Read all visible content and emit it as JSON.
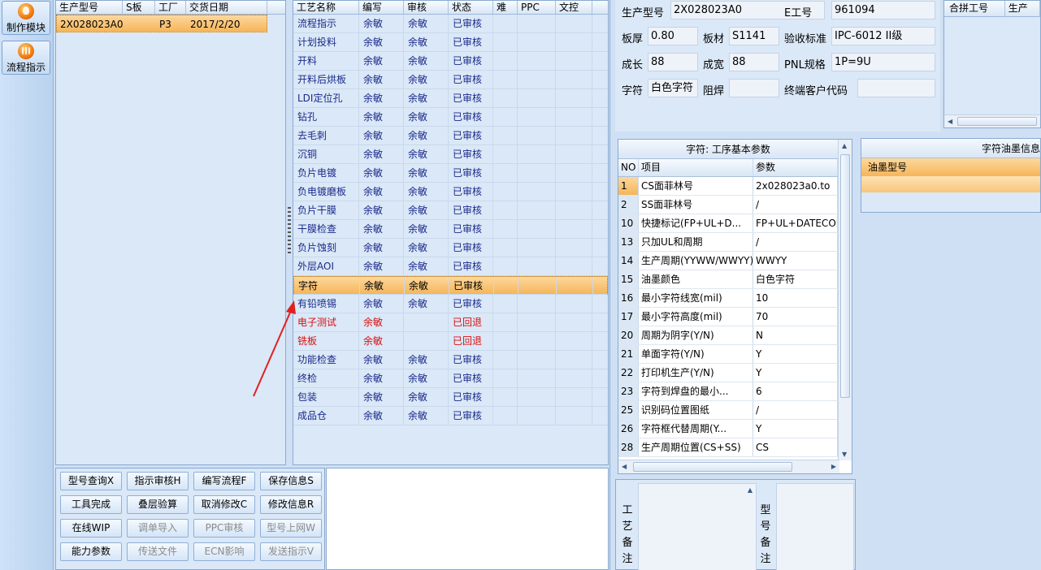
{
  "toolbar": {
    "make_module": "制作模块",
    "flow_guide": "流程指示"
  },
  "model_list": {
    "columns": [
      "生产型号",
      "S板",
      "工厂",
      "交货日期"
    ],
    "rows": [
      {
        "model": "2X028023A0",
        "s_board": "",
        "factory": "P3",
        "delivery": "2017/2/20"
      }
    ]
  },
  "process_table": {
    "columns": [
      "工艺名称",
      "编写",
      "审核",
      "状态",
      "难",
      "PPC",
      "文控"
    ],
    "rows": [
      {
        "name": "流程指示",
        "writer": "余敏",
        "reviewer": "余敏",
        "status": "已审核"
      },
      {
        "name": "计划投料",
        "writer": "余敏",
        "reviewer": "余敏",
        "status": "已审核"
      },
      {
        "name": "开料",
        "writer": "余敏",
        "reviewer": "余敏",
        "status": "已审核"
      },
      {
        "name": "开料后烘板",
        "writer": "余敏",
        "reviewer": "余敏",
        "status": "已审核"
      },
      {
        "name": "LDI定位孔",
        "writer": "余敏",
        "reviewer": "余敏",
        "status": "已审核"
      },
      {
        "name": "钻孔",
        "writer": "余敏",
        "reviewer": "余敏",
        "status": "已审核"
      },
      {
        "name": "去毛刺",
        "writer": "余敏",
        "reviewer": "余敏",
        "status": "已审核"
      },
      {
        "name": "沉铜",
        "writer": "余敏",
        "reviewer": "余敏",
        "status": "已审核"
      },
      {
        "name": "负片电镀",
        "writer": "余敏",
        "reviewer": "余敏",
        "status": "已审核"
      },
      {
        "name": "负电镀磨板",
        "writer": "余敏",
        "reviewer": "余敏",
        "status": "已审核"
      },
      {
        "name": "负片干膜",
        "writer": "余敏",
        "reviewer": "余敏",
        "status": "已审核"
      },
      {
        "name": "干膜检查",
        "writer": "余敏",
        "reviewer": "余敏",
        "status": "已审核"
      },
      {
        "name": "负片蚀刻",
        "writer": "余敏",
        "reviewer": "余敏",
        "status": "已审核"
      },
      {
        "name": "外层AOI",
        "writer": "余敏",
        "reviewer": "余敏",
        "status": "已审核"
      },
      {
        "name": "字符",
        "writer": "余敏",
        "reviewer": "余敏",
        "status": "已审核"
      },
      {
        "name": "有铅喷锡",
        "writer": "余敏",
        "reviewer": "余敏",
        "status": "已审核"
      },
      {
        "name": "电子测试",
        "writer": "余敏",
        "reviewer": "",
        "status": "已回退"
      },
      {
        "name": "铣板",
        "writer": "余敏",
        "reviewer": "",
        "status": "已回退"
      },
      {
        "name": "功能检查",
        "writer": "余敏",
        "reviewer": "余敏",
        "status": "已审核"
      },
      {
        "name": "终检",
        "writer": "余敏",
        "reviewer": "余敏",
        "status": "已审核"
      },
      {
        "name": "包装",
        "writer": "余敏",
        "reviewer": "余敏",
        "status": "已审核"
      },
      {
        "name": "成品仓",
        "writer": "余敏",
        "reviewer": "余敏",
        "status": "已审核"
      }
    ]
  },
  "buttons": {
    "model_query": "型号查询X",
    "guide_review": "指示审核H",
    "edit_flow": "编写流程F",
    "save_info": "保存信息S",
    "tool_done": "工具完成",
    "stack_calc": "叠层验算",
    "cancel_edit": "取消修改C",
    "modify_info": "修改信息R",
    "online_wip": "在线WIP",
    "import_sheet": "调单导入",
    "ppc_review": "PPC审核",
    "model_online": "型号上网W",
    "capability": "能力参数",
    "send_file": "传送文件",
    "ecn_impact": "ECN影响",
    "send_guide": "发送指示V"
  },
  "info": {
    "model_label": "生产型号",
    "model_value": "2X028023A0",
    "e_label": "E工号",
    "e_value": "961094",
    "thickness_label": "板厚",
    "thickness_value": "0.80",
    "material_label": "板材",
    "material_value": "S1141",
    "standard_label": "验收标准",
    "standard_value": "IPC-6012 II级",
    "length_label": "成长",
    "length_value": "88",
    "width_label": "成宽",
    "width_value": "88",
    "pnl_label": "PNL规格",
    "pnl_value": "1P=9U",
    "char_label": "字符",
    "char_value": "白色字符",
    "mask_label": "阻焊",
    "mask_value": "",
    "customer_label": "终端客户代码",
    "customer_value": ""
  },
  "right_top": {
    "col1": "合拼工号",
    "col2": "生产"
  },
  "params": {
    "title": "字符: 工序基本参数",
    "columns": [
      "NO",
      "项目",
      "参数"
    ],
    "rows": [
      {
        "no": "1",
        "item": "CS面菲林号",
        "value": "2x028023a0.to"
      },
      {
        "no": "2",
        "item": "SS面菲林号",
        "value": "/"
      },
      {
        "no": "10",
        "item": "快捷标记(FP+UL+D...",
        "value": "FP+UL+DATECODE"
      },
      {
        "no": "13",
        "item": "只加UL和周期",
        "value": "/"
      },
      {
        "no": "14",
        "item": "生产周期(YYWW/WWYY)",
        "value": "WWYY"
      },
      {
        "no": "15",
        "item": "油墨颜色",
        "value": "白色字符"
      },
      {
        "no": "16",
        "item": "最小字符线宽(mil)",
        "value": "10"
      },
      {
        "no": "17",
        "item": "最小字符高度(mil)",
        "value": "70"
      },
      {
        "no": "20",
        "item": "周期为阴字(Y/N)",
        "value": "N"
      },
      {
        "no": "21",
        "item": "单面字符(Y/N)",
        "value": "Y"
      },
      {
        "no": "22",
        "item": "打印机生产(Y/N)",
        "value": "Y"
      },
      {
        "no": "23",
        "item": "字符到焊盘的最小...",
        "value": "6"
      },
      {
        "no": "25",
        "item": "识别码位置图纸",
        "value": "/"
      },
      {
        "no": "26",
        "item": "字符框代替周期(Y...",
        "value": "Y"
      },
      {
        "no": "28",
        "item": "生产周期位置(CS+SS)",
        "value": "CS"
      }
    ]
  },
  "ink": {
    "title": "字符油墨信息",
    "column": "油墨型号"
  },
  "remarks": {
    "process_label": "工艺备注",
    "model_label": "型号备注"
  },
  "colors": {
    "selection": "#f5b55a",
    "rollback_text": "#d81010",
    "arrow": "#e02020"
  }
}
